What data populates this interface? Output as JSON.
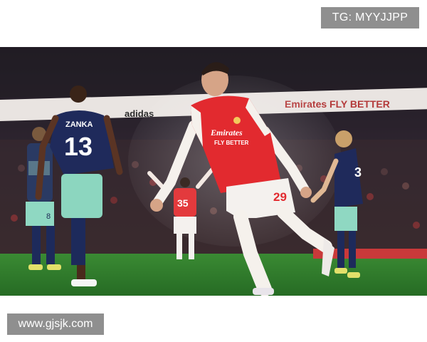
{
  "watermark_top": "TG: MYYJJPP",
  "watermark_bottom": "www.gjsjk.com",
  "photo": {
    "ad_board": {
      "brand_left": "adidas",
      "brand_right_text": "Emirates FLY BETTER"
    },
    "players": {
      "main": {
        "sponsor_line1": "Emirates",
        "sponsor_line2": "FLY BETTER",
        "shorts_number": "29"
      },
      "left_back": {
        "name": "ZANKA",
        "number": "13",
        "shorts_number": "8"
      },
      "background_teammate": {
        "number": "35"
      },
      "right_opponent": {
        "number": "3"
      }
    },
    "colors": {
      "pitch": "#2f7a2c",
      "pitch_dark": "#245f22",
      "home_red": "#e22a2f",
      "away_navy": "#1f2a5b",
      "away_mint": "#7fd6bd",
      "crowd": "#2a2328"
    }
  }
}
